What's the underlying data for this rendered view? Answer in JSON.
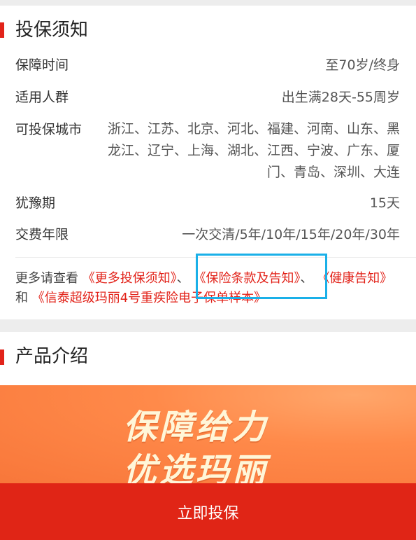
{
  "notice": {
    "title": "投保须知",
    "rows": [
      {
        "label": "保障时间",
        "value": "至70岁/终身"
      },
      {
        "label": "适用人群",
        "value": "出生满28天-55周岁"
      },
      {
        "label": "可投保城市",
        "value": "浙江、江苏、北京、河北、福建、河南、山东、黑龙江、辽宁、上海、湖北、江西、宁波、广东、厦门、青岛、深圳、大连"
      },
      {
        "label": "犹豫期",
        "value": "15天"
      },
      {
        "label": "交费年限",
        "value": "一次交清/5年/10年/15年/20年/30年"
      }
    ],
    "more": {
      "prefix": "更多请查看",
      "link1": "《更多投保须知》",
      "sep1": "、",
      "link2": "《保险条款及告知》",
      "sep2": "、",
      "link3": "《健康告知》",
      "and": "和",
      "link4": "《信泰超级玛丽4号重疾险电子保单样本》"
    }
  },
  "product": {
    "title": "产品介绍",
    "banner_line1": "保障给力",
    "banner_line2": "优选玛丽"
  },
  "cta": {
    "label": "立即投保"
  },
  "colors": {
    "accent": "#e2231a",
    "highlight": "#1ab0e8",
    "banner": "#ff8a4a"
  }
}
